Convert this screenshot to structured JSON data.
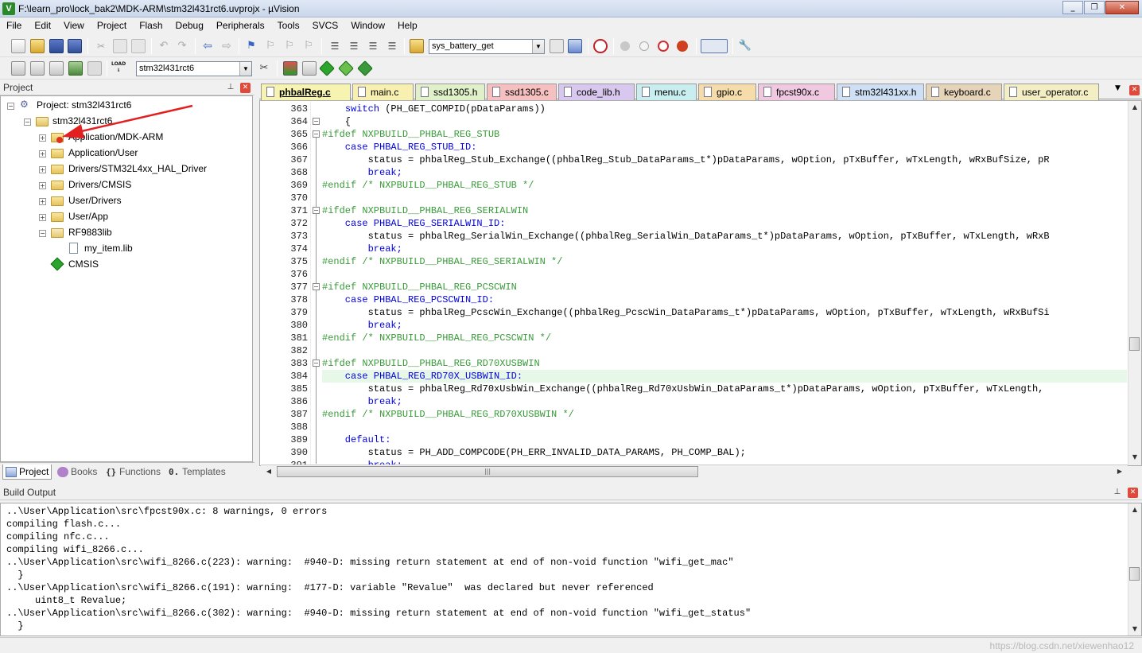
{
  "window": {
    "title": "F:\\learn_pro\\lock_bak2\\MDK-ARM\\stm32l431rct6.uvprojx - µVision",
    "app_icon_letter": "V"
  },
  "menu": [
    "File",
    "Edit",
    "View",
    "Project",
    "Flash",
    "Debug",
    "Peripherals",
    "Tools",
    "SVCS",
    "Window",
    "Help"
  ],
  "toolbar1": {
    "find_combo": "sys_battery_get"
  },
  "toolbar2": {
    "target_combo": "stm32l431rct6",
    "load_label": "LOAD"
  },
  "project_panel": {
    "title": "Project",
    "root": "Project: stm32l431rct6",
    "target": "stm32l431rct6",
    "groups": [
      "Application/MDK-ARM",
      "Application/User",
      "Drivers/STM32L4xx_HAL_Driver",
      "Drivers/CMSIS",
      "User/Drivers",
      "User/App",
      "RF9883lib"
    ],
    "lib_file": "my_item.lib",
    "cmsis": "CMSIS"
  },
  "bottom_tabs": [
    "Project",
    "Books",
    "Functions",
    "Templates"
  ],
  "editor_tabs": [
    {
      "label": "phbalReg.c",
      "color": "#f7f3b0",
      "active": true
    },
    {
      "label": "main.c",
      "color": "#f7f0b0"
    },
    {
      "label": "ssd1305.h",
      "color": "#e0f0c8"
    },
    {
      "label": "ssd1305.c",
      "color": "#f6c0c0"
    },
    {
      "label": "code_lib.h",
      "color": "#d8c8f0"
    },
    {
      "label": "menu.c",
      "color": "#c8eef0"
    },
    {
      "label": "gpio.c",
      "color": "#f5dcaa"
    },
    {
      "label": "fpcst90x.c",
      "color": "#f0c8e0"
    },
    {
      "label": "stm32l431xx.h",
      "color": "#cfe0f5"
    },
    {
      "label": "keyboard.c",
      "color": "#e6d4b8"
    },
    {
      "label": "user_operator.c",
      "color": "#f4eec4"
    }
  ],
  "code_lines": [
    {
      "n": "363",
      "t": "    switch (PH_GET_COMPID(pDataParams))"
    },
    {
      "n": "364",
      "t": "    {"
    },
    {
      "n": "365",
      "t": "#ifdef NXPBUILD__PHBAL_REG_STUB"
    },
    {
      "n": "366",
      "t": "    case PHBAL_REG_STUB_ID:"
    },
    {
      "n": "367",
      "t": "        status = phbalReg_Stub_Exchange((phbalReg_Stub_DataParams_t*)pDataParams, wOption, pTxBuffer, wTxLength, wRxBufSize, pR"
    },
    {
      "n": "368",
      "t": "        break;"
    },
    {
      "n": "369",
      "t": "#endif /* NXPBUILD__PHBAL_REG_STUB */"
    },
    {
      "n": "370",
      "t": ""
    },
    {
      "n": "371",
      "t": "#ifdef NXPBUILD__PHBAL_REG_SERIALWIN"
    },
    {
      "n": "372",
      "t": "    case PHBAL_REG_SERIALWIN_ID:"
    },
    {
      "n": "373",
      "t": "        status = phbalReg_SerialWin_Exchange((phbalReg_SerialWin_DataParams_t*)pDataParams, wOption, pTxBuffer, wTxLength, wRxB"
    },
    {
      "n": "374",
      "t": "        break;"
    },
    {
      "n": "375",
      "t": "#endif /* NXPBUILD__PHBAL_REG_SERIALWIN */"
    },
    {
      "n": "376",
      "t": ""
    },
    {
      "n": "377",
      "t": "#ifdef NXPBUILD__PHBAL_REG_PCSCWIN"
    },
    {
      "n": "378",
      "t": "    case PHBAL_REG_PCSCWIN_ID:"
    },
    {
      "n": "379",
      "t": "        status = phbalReg_PcscWin_Exchange((phbalReg_PcscWin_DataParams_t*)pDataParams, wOption, pTxBuffer, wTxLength, wRxBufSi"
    },
    {
      "n": "380",
      "t": "        break;"
    },
    {
      "n": "381",
      "t": "#endif /* NXPBUILD__PHBAL_REG_PCSCWIN */"
    },
    {
      "n": "382",
      "t": ""
    },
    {
      "n": "383",
      "t": "#ifdef NXPBUILD__PHBAL_REG_RD70XUSBWIN"
    },
    {
      "n": "384",
      "t": "    case PHBAL_REG_RD70X_USBWIN_ID:"
    },
    {
      "n": "385",
      "t": "        status = phbalReg_Rd70xUsbWin_Exchange((phbalReg_Rd70xUsbWin_DataParams_t*)pDataParams, wOption, pTxBuffer, wTxLength, "
    },
    {
      "n": "386",
      "t": "        break;"
    },
    {
      "n": "387",
      "t": "#endif /* NXPBUILD__PHBAL_REG_RD70XUSBWIN */"
    },
    {
      "n": "388",
      "t": ""
    },
    {
      "n": "389",
      "t": "    default:"
    },
    {
      "n": "390",
      "t": "        status = PH_ADD_COMPCODE(PH_ERR_INVALID_DATA_PARAMS, PH_COMP_BAL);"
    },
    {
      "n": "391",
      "t": "        break;"
    }
  ],
  "build_output": {
    "title": "Build Output",
    "lines": [
      "..\\User\\Application\\src\\fpcst90x.c: 8 warnings, 0 errors",
      "compiling flash.c...",
      "compiling nfc.c...",
      "compiling wifi_8266.c...",
      "..\\User\\Application\\src\\wifi_8266.c(223): warning:  #940-D: missing return statement at end of non-void function \"wifi_get_mac\"",
      "  }",
      "..\\User\\Application\\src\\wifi_8266.c(191): warning:  #177-D: variable \"Revalue\"  was declared but never referenced",
      "     uint8_t Revalue;",
      "..\\User\\Application\\src\\wifi_8266.c(302): warning:  #940-D: missing return statement at end of non-void function \"wifi_get_status\"",
      "  }"
    ]
  },
  "watermark": "https://blog.csdn.net/xiewenhao12"
}
